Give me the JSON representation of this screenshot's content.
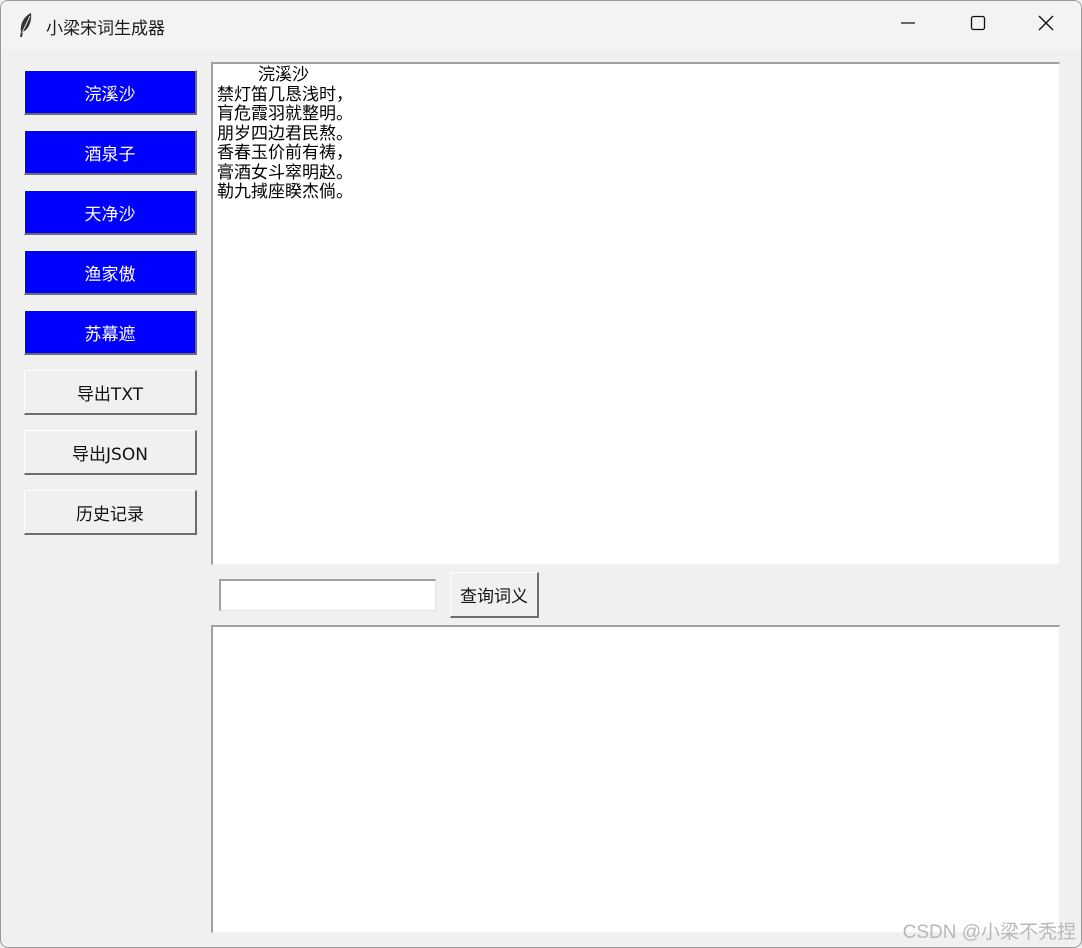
{
  "window": {
    "title": "小梁宋词生成器",
    "app_icon": "feather-icon",
    "controls": {
      "minimize": "minimize-icon",
      "maximize": "maximize-icon",
      "close": "close-icon"
    }
  },
  "sidebar": {
    "buttons": [
      {
        "label": "浣溪沙",
        "style": "blue"
      },
      {
        "label": "酒泉子",
        "style": "blue"
      },
      {
        "label": "天净沙",
        "style": "blue"
      },
      {
        "label": "渔家傲",
        "style": "blue"
      },
      {
        "label": "苏幕遮",
        "style": "blue"
      },
      {
        "label": "导出TXT",
        "style": "gray"
      },
      {
        "label": "导出JSON",
        "style": "gray"
      },
      {
        "label": "历史记录",
        "style": "gray"
      }
    ]
  },
  "poem": {
    "text": "    浣溪沙\n禁灯笛几恳浅时，\n肓危霞羽就整明。\n朋岁四边君民熬。\n香春玉价前有祷，\n膏酒女斗窣明赵。\n勒九掝座睽杰倘。"
  },
  "query": {
    "input_value": "",
    "button_label": "查询词义"
  },
  "result": {
    "text": ""
  },
  "watermark": "CSDN @小梁不秃捏",
  "colors": {
    "accent_button": "#0000ff",
    "accent_text": "#ffffff"
  }
}
